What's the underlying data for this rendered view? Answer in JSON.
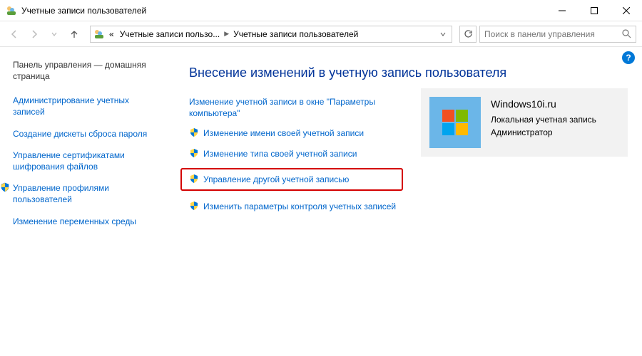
{
  "window": {
    "title": "Учетные записи пользователей"
  },
  "breadcrumb": {
    "prefix": "«",
    "item1": "Учетные записи пользо...",
    "item2": "Учетные записи пользователей"
  },
  "search": {
    "placeholder": "Поиск в панели управления"
  },
  "sidebar": {
    "home": "Панель управления — домашняя страница",
    "links": [
      "Администрирование учетных записей",
      "Создание дискеты сброса пароля",
      "Управление сертификатами шифрования файлов",
      "Управление профилями пользователей",
      "Изменение переменных среды"
    ]
  },
  "main": {
    "title": "Внесение изменений в учетную запись пользователя",
    "actions": [
      "Изменение учетной записи в окне \"Параметры компьютера\"",
      "Изменение имени своей учетной записи",
      "Изменение типа своей учетной записи",
      "Управление другой учетной записью",
      "Изменить параметры контроля учетных записей"
    ]
  },
  "user": {
    "name": "Windows10i.ru",
    "type": "Локальная учетная запись",
    "role": "Администратор"
  }
}
